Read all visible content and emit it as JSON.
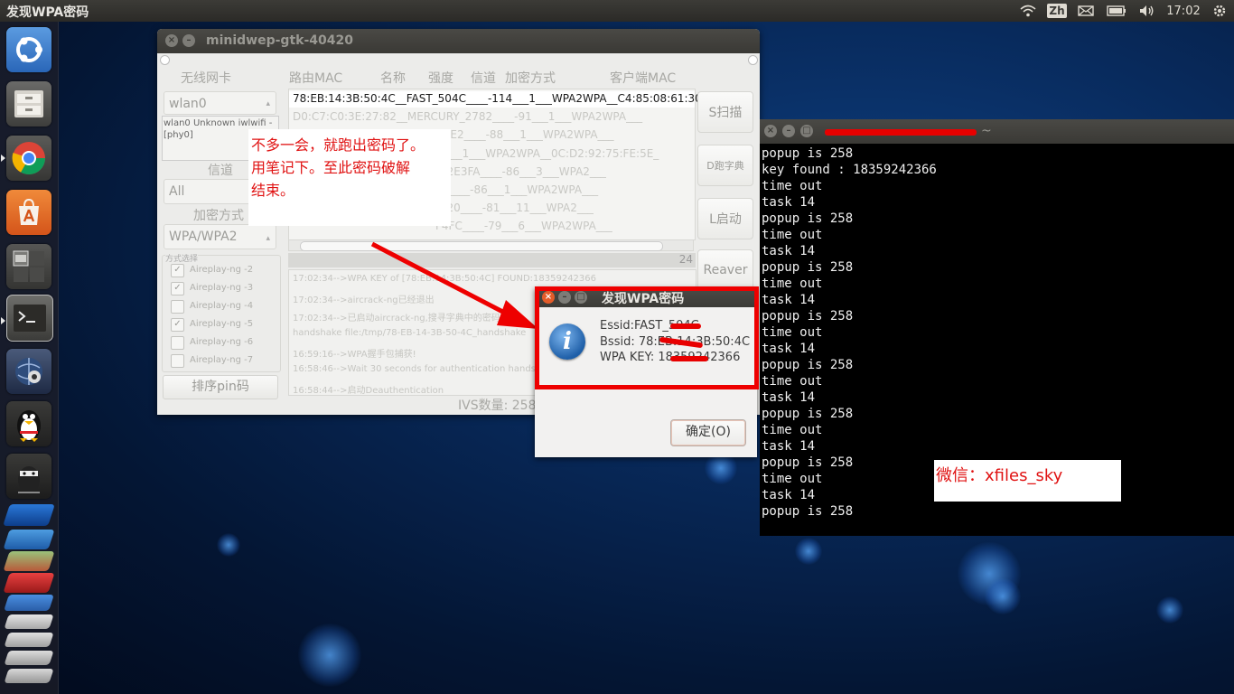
{
  "topbar": {
    "app_title": "发现WPA密码",
    "input_method": "Zh",
    "clock": "17:02",
    "icons": [
      "wifi-icon",
      "keyboard-icon",
      "mail-icon",
      "battery-icon",
      "volume-icon",
      "power-gear-icon"
    ]
  },
  "launcher": {
    "items": [
      "dash-home",
      "files",
      "chromium",
      "software-center",
      "workspaces",
      "terminal",
      "network-tool",
      "qq-penguin",
      "inkscape-ninja",
      "app-stack"
    ]
  },
  "minidwep": {
    "title": "minidwep-gtk-40420",
    "labels": {
      "wireless_card": "无线网卡",
      "channel": "信道",
      "encryption": "加密方式",
      "method_group": "方式选择"
    },
    "iface_value": "wlan0",
    "iface_info": "wlan0 Unknown iwlwifi - [phy0]",
    "channel_value": "All",
    "encryption_value": "WPA/WPA2",
    "attack_methods": [
      {
        "label": "Aireplay-ng -2",
        "checked": true
      },
      {
        "label": "Aireplay-ng -3",
        "checked": true
      },
      {
        "label": "Aireplay-ng -4",
        "checked": false
      },
      {
        "label": "Aireplay-ng -5",
        "checked": true
      },
      {
        "label": "Aireplay-ng -6",
        "checked": false
      },
      {
        "label": "Aireplay-ng -7",
        "checked": false
      }
    ],
    "sort_pin_button": "排序pin码",
    "columns": [
      "路由MAC",
      "名称",
      "强度",
      "信道",
      "加密方式",
      "客户端MAC"
    ],
    "networks": [
      "78:EB:14:3B:50:4C__FAST_504C____-114___1___WPA2WPA__C4:85:08:61:30",
      "D0:C7:C0:3E:27:82__MERCURY_2782____-91___1___WPA2WPA___",
      "CE2____-88___1___WPA2WPA___",
      "-86___1___WPA2WPA__0C:D2:92:75:FE:5E_",
      "_62E3FA____-86___3___WPA2___",
      "26qf____-86___1___WPA2WPA___",
      "281b20____-81___11___WPA2___",
      "F4FC____-79___6___WPA2WPA___"
    ],
    "count_24": "24",
    "buttons": {
      "scan": "S扫描",
      "dict": "D跑字典",
      "start": "L启动",
      "reaver": "Reaver"
    },
    "log_lines": [
      "17:02:34-->WPA KEY of [78:EB:14:3B:50:4C] FOUND:18359242366",
      "17:02:34-->aircrack-ng已经退出",
      "17:02:34-->已启动aircrack-ng,搜寻字典中的密码",
      "handshake file:/tmp/78-EB-14-3B-50-4C_handshake",
      "16:59:16-->WPA握手包捕获!",
      "16:58:46-->Wait 30 seconds for authentication handshake",
      "16:58:44-->启动Deauthentication"
    ],
    "ivs_label": "IVS数量: 258"
  },
  "annotation": {
    "lines": [
      "不多一会，就跑出密码了。",
      "用笔记下。至此密码破解",
      "结束。"
    ]
  },
  "terminal": {
    "title_suffix": "~",
    "lines": [
      "popup is 258",
      "key found : 18359242366",
      "time out",
      "task 14",
      "popup is 258",
      "time out",
      "task 14",
      "popup is 258",
      "time out",
      "task 14",
      "popup is 258",
      "time out",
      "task 14",
      "popup is 258",
      "time out",
      "task 14",
      "popup is 258",
      "time out",
      "task 14",
      "popup is 258",
      "time out",
      "task 14",
      "popup is 258"
    ]
  },
  "wechat_note": "微信：xfiles_sky",
  "dialog": {
    "title": "发现WPA密码",
    "essid": "Essid:FAST_504C",
    "bssid": "Bssid: 78:EB:14:3B:50:4C",
    "wpa_key": "WPA KEY: 18359242366",
    "ok_button": "确定(O)",
    "icon": "info-icon"
  },
  "colors": {
    "annotation_red": "#ee0000",
    "panel": "#3c3b37",
    "terminal_bg": "#000000"
  }
}
